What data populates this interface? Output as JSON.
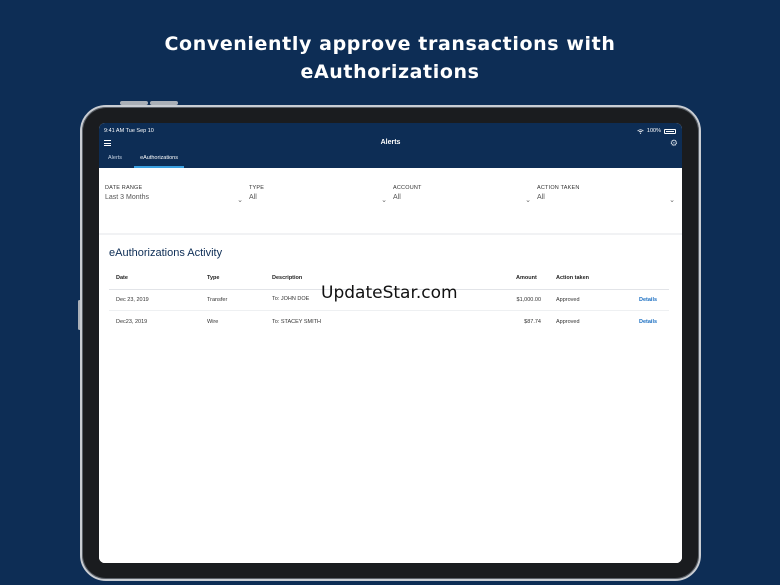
{
  "headline": {
    "line1": "Conveniently approve transactions with",
    "line2": "eAuthorizations"
  },
  "status_bar": {
    "time": "9:41 AM  Tue Sep 10",
    "battery": "100%"
  },
  "nav": {
    "title": "Alerts"
  },
  "tabs": [
    {
      "label": "Alerts"
    },
    {
      "label": "eAuthorizations",
      "active": true
    }
  ],
  "filters": [
    {
      "label": "DATE RANGE",
      "value": "Last 3 Months"
    },
    {
      "label": "TYPE",
      "value": "All"
    },
    {
      "label": "ACCOUNT",
      "value": "All"
    },
    {
      "label": "ACTION TAKEN",
      "value": "All"
    }
  ],
  "activity": {
    "title": "eAuthorizations Activity",
    "columns": [
      "Date",
      "Type",
      "Description",
      "Amount",
      "Action taken"
    ],
    "rows": [
      {
        "date": "Dec 23, 2019",
        "type": "Transfer",
        "description": "To: JOHN DOE",
        "amount": "$1,000.00",
        "action": "Approved",
        "link": "Details"
      },
      {
        "date": "Dec23, 2019",
        "type": "Wire",
        "description": "To: STACEY SMITH",
        "amount": "$87.74",
        "action": "Approved",
        "link": "Details"
      }
    ]
  },
  "watermark": "UpdateStar.com",
  "colors": {
    "navy": "#0d2d55",
    "link": "#1b6fc2",
    "tab_indicator": "#3aa0e0"
  }
}
